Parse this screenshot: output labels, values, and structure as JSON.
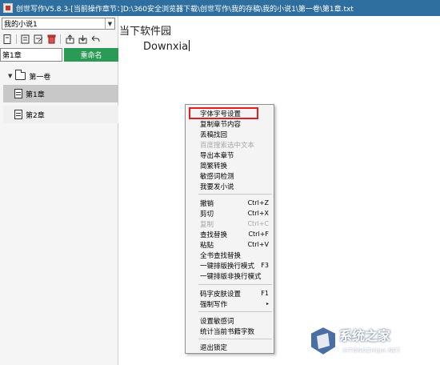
{
  "window": {
    "title": "创世写作V5.8.3-[当前操作章节：]D:\\360安全浏览器下载\\创世写作\\我的存稿\\我的小说1\\第一卷\\第1章.txt"
  },
  "left_panel": {
    "book_select": {
      "value": "我的小说1"
    },
    "toolbar": {
      "icons": [
        "new-document-icon",
        "chapter-icon",
        "edit-chapter-icon",
        "delete-icon",
        "upload-icon",
        "download-icon",
        "undo-arrow-icon"
      ]
    },
    "chapter_name_input": {
      "value": "第1章"
    },
    "rename_button": {
      "label": "重命名"
    },
    "tree": {
      "volume": {
        "label": "第一卷"
      },
      "chapters": [
        {
          "label": "第1章",
          "selected": true
        },
        {
          "label": "第2章",
          "selected": false
        }
      ]
    }
  },
  "editor": {
    "lines": [
      "当下软件园",
      "Downxia"
    ]
  },
  "context_menu": {
    "items": [
      {
        "label": "字体字号设置",
        "shortcut": "",
        "disabled": false,
        "highlighted": true
      },
      {
        "label": "复制章节内容",
        "shortcut": "",
        "disabled": false
      },
      {
        "label": "丢稿找回",
        "shortcut": "",
        "disabled": false
      },
      {
        "label": "百度搜索选中文本",
        "shortcut": "",
        "disabled": true
      },
      {
        "label": "导出本章节",
        "shortcut": "",
        "disabled": false
      },
      {
        "label": "简繁转换",
        "shortcut": "",
        "disabled": false
      },
      {
        "label": "敏感词检测",
        "shortcut": "",
        "disabled": false
      },
      {
        "label": "我要发小说",
        "shortcut": "",
        "disabled": false
      },
      {
        "label": "撤销",
        "shortcut": "Ctrl+Z",
        "disabled": false
      },
      {
        "label": "剪切",
        "shortcut": "Ctrl+X",
        "disabled": false
      },
      {
        "label": "复制",
        "shortcut": "Ctrl+C",
        "disabled": true
      },
      {
        "label": "查找替换",
        "shortcut": "Ctrl+F",
        "disabled": false
      },
      {
        "label": "粘贴",
        "shortcut": "Ctrl+V",
        "disabled": false
      },
      {
        "label": "全书查找替换",
        "shortcut": "",
        "disabled": false
      },
      {
        "label": "一键排版换行模式",
        "shortcut": "F3",
        "disabled": false
      },
      {
        "label": "一键排版非换行模式",
        "shortcut": "",
        "disabled": false
      },
      {
        "label": "码字皮肤设置",
        "shortcut": "F1",
        "disabled": false
      },
      {
        "label": "强制写作",
        "shortcut": "",
        "disabled": false,
        "submenu": true
      },
      {
        "label": "设置敏感词",
        "shortcut": "",
        "disabled": false
      },
      {
        "label": "统计当前书籍字数",
        "shortcut": "",
        "disabled": false
      },
      {
        "label": "退出锁定",
        "shortcut": "",
        "disabled": false
      }
    ],
    "submenu_arrow": "▸"
  },
  "watermark": {
    "text": "系统之家",
    "url": "XITONGZHIJIA.NET"
  },
  "colors": {
    "titlebar": "#2f6f9f",
    "rename_button": "#2b9a57",
    "highlight_box": "#e02020",
    "selected_row": "#c8c8c8"
  }
}
